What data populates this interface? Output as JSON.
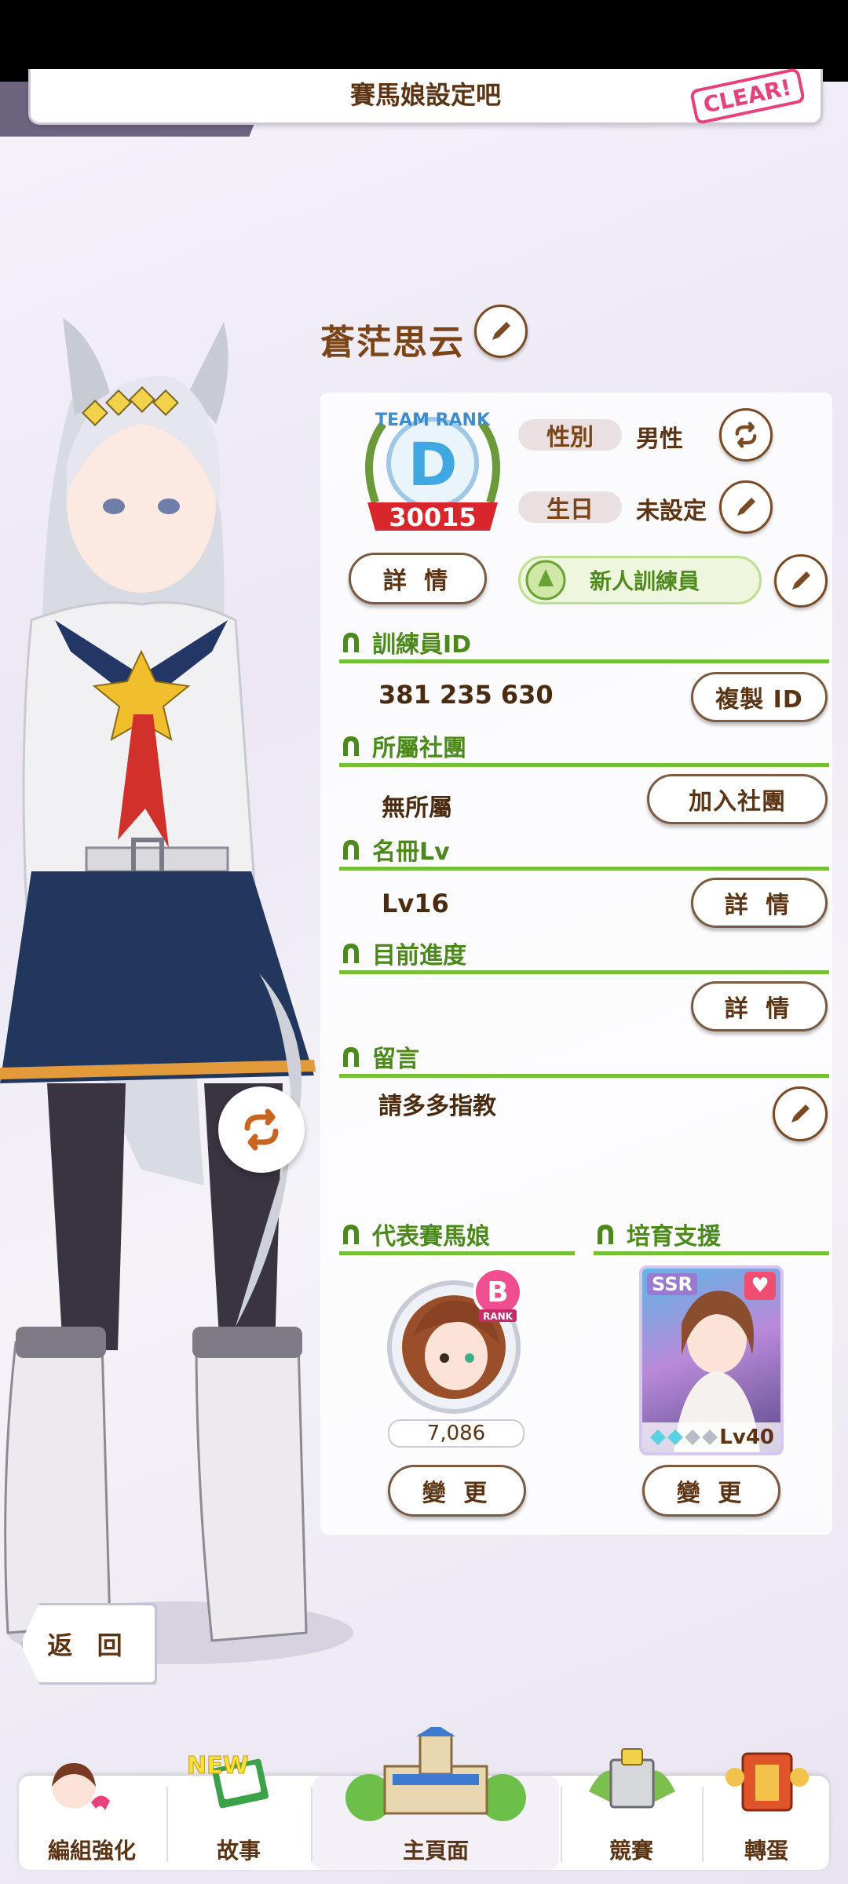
{
  "banner": {
    "mission_text": "賽馬娘設定吧",
    "stamp": "CLEAR!"
  },
  "profile": {
    "name": "蒼茫思云",
    "team_rank": {
      "label": "TEAM RANK",
      "grade": "D",
      "score": "30015"
    },
    "gender": {
      "label": "性別",
      "value": "男性"
    },
    "birthday": {
      "label": "生日",
      "value": "未設定"
    },
    "detail_button": "詳 情",
    "title_badge": "新人訓練員"
  },
  "sections": {
    "trainer_id": {
      "title": "訓練員ID",
      "value": "381 235 630",
      "button": "複製 ID"
    },
    "club": {
      "title": "所屬社團",
      "value": "無所屬",
      "button": "加入社團"
    },
    "roster": {
      "title": "名冊Lv",
      "value": "Lv16",
      "button": "詳 情"
    },
    "progress": {
      "title": "目前進度",
      "value": "",
      "button": "詳 情"
    },
    "message": {
      "title": "留言",
      "value": "請多多指教"
    },
    "rep_uma": {
      "title": "代表賽馬娘",
      "rank": "B",
      "rank_sub": "RANK",
      "score": "7,086",
      "button": "變 更"
    },
    "support": {
      "title": "培育支援",
      "rarity": "SSR",
      "level": "Lv40",
      "button": "變 更"
    }
  },
  "back_button": "返 回",
  "nav": {
    "items": [
      {
        "label": "編組強化"
      },
      {
        "label": "故事",
        "badge": "NEW"
      },
      {
        "label": "主頁面"
      },
      {
        "label": "競賽"
      },
      {
        "label": "轉蛋"
      }
    ]
  },
  "colors": {
    "accent_green": "#78c033",
    "brown_text": "#5c3414",
    "rank_red": "#d9262c"
  }
}
